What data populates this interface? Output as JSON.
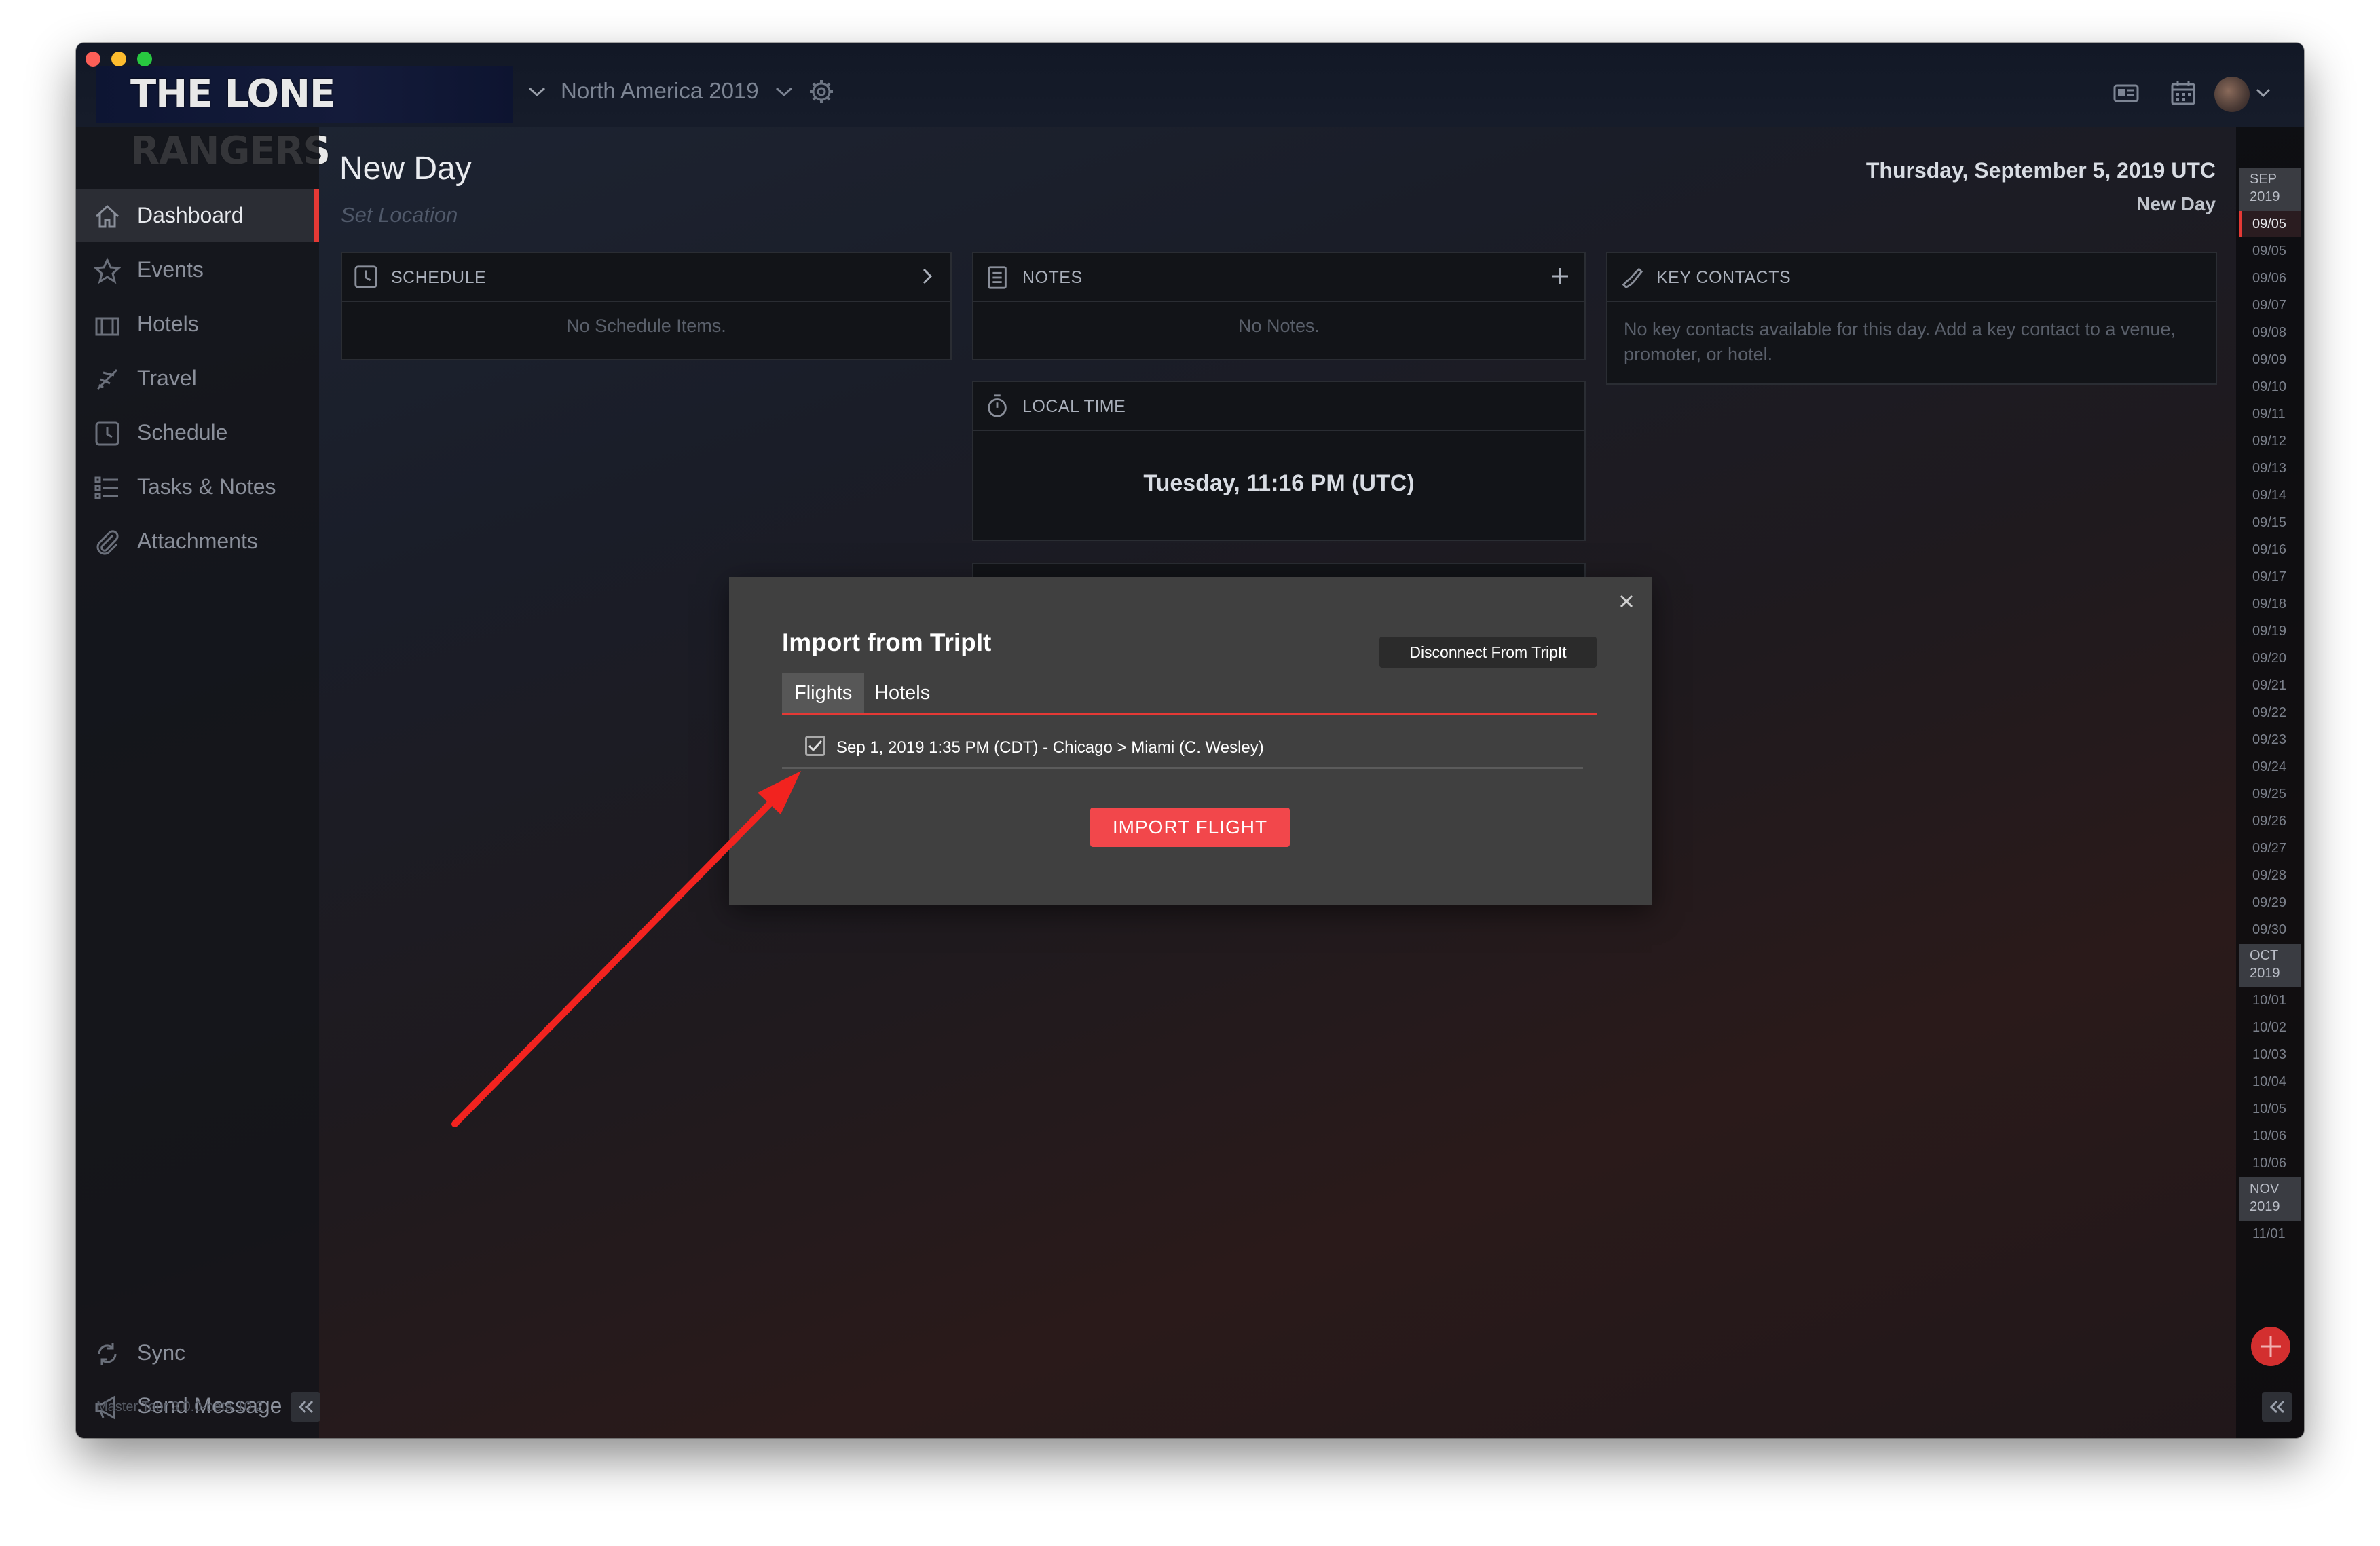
{
  "app": {
    "logo_text": "THE LONE RANGERS",
    "project_name": "North America 2019",
    "version": "Master Tour 3.0.0-beta.10.2"
  },
  "sidebar": {
    "items": [
      {
        "label": "Dashboard",
        "icon": "home-icon"
      },
      {
        "label": "Events",
        "icon": "star-icon"
      },
      {
        "label": "Hotels",
        "icon": "hotel-icon"
      },
      {
        "label": "Travel",
        "icon": "plane-icon"
      },
      {
        "label": "Schedule",
        "icon": "clock-icon"
      },
      {
        "label": "Tasks & Notes",
        "icon": "list-icon"
      },
      {
        "label": "Attachments",
        "icon": "paperclip-icon"
      }
    ],
    "bottom_items": [
      {
        "label": "Sync",
        "icon": "sync-icon"
      },
      {
        "label": "Send Message",
        "icon": "megaphone-icon"
      }
    ]
  },
  "page": {
    "title": "New Day",
    "location_placeholder": "Set Location",
    "date": "Thursday, September 5, 2019 UTC",
    "day_name": "New Day"
  },
  "cards": {
    "schedule": {
      "title": "SCHEDULE",
      "empty": "No Schedule Items."
    },
    "notes": {
      "title": "NOTES",
      "empty": "No Notes."
    },
    "key_contacts": {
      "title": "KEY CONTACTS",
      "empty": "No key contacts available for this day. Add a key contact to a venue, promoter, or hotel."
    },
    "local_time": {
      "title": "LOCAL TIME",
      "value": "Tuesday, 11:16 PM (UTC)"
    }
  },
  "calendar": {
    "months": [
      {
        "label": "SEP",
        "year": "2019"
      },
      {
        "label": "OCT",
        "year": "2019"
      },
      {
        "label": "NOV",
        "year": "2019"
      }
    ],
    "sep_days": [
      "09/05",
      "09/05",
      "09/06",
      "09/07",
      "09/08",
      "09/09",
      "09/10",
      "09/11",
      "09/12",
      "09/13",
      "09/14",
      "09/15",
      "09/16",
      "09/17",
      "09/18",
      "09/19",
      "09/20",
      "09/21",
      "09/22",
      "09/23",
      "09/24",
      "09/25",
      "09/26",
      "09/27",
      "09/28",
      "09/29",
      "09/30"
    ],
    "oct_days": [
      "10/01",
      "10/02",
      "10/03",
      "10/04",
      "10/05",
      "10/06",
      "10/06"
    ],
    "nov_days": [
      "11/01"
    ],
    "selected_index": 0
  },
  "modal": {
    "title": "Import from TripIt",
    "disconnect_label": "Disconnect From TripIt",
    "tabs": [
      "Flights",
      "Hotels"
    ],
    "active_tab": 0,
    "flight": {
      "text": "Sep 1, 2019 1:35 PM (CDT) - Chicago > Miami (C. Wesley)",
      "checked": true
    },
    "import_label": "IMPORT FLIGHT"
  },
  "colors": {
    "accent": "#e53935",
    "import_button": "#f2474b",
    "modal_bg": "#404040"
  }
}
